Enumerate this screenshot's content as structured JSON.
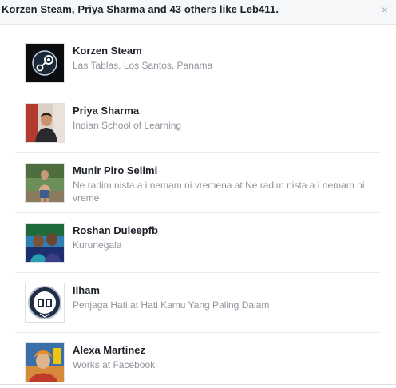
{
  "header": {
    "title": "Korzen Steam, Priya Sharma and 43 others like Leb411.",
    "close_glyph": "×"
  },
  "people": [
    {
      "name": "Korzen Steam",
      "subtitle": "Las Tablas, Los Santos, Panama",
      "avatar": "steam-logo-icon"
    },
    {
      "name": "Priya Sharma",
      "subtitle": "Indian School of Learning",
      "avatar": "profile-photo"
    },
    {
      "name": "Munir Piro Selimi",
      "subtitle": "Ne radim nista a i nemam ni vremena at Ne radim nista a i nemam ni vreme",
      "avatar": "profile-photo"
    },
    {
      "name": "Roshan Duleepfb",
      "subtitle": "Kurunegala",
      "avatar": "profile-photo"
    },
    {
      "name": "Ilham",
      "subtitle": "Penjaga Hati at Hati Kamu Yang Paling Dalam",
      "avatar": "official-blog-badge-icon"
    },
    {
      "name": "Alexa Martinez",
      "subtitle": "Works at Facebook",
      "avatar": "profile-photo"
    }
  ],
  "colors": {
    "header_bg": "#f6f7f9",
    "name_text": "#1d2129",
    "subtitle_text": "#90949c",
    "divider": "#e9ebee"
  }
}
